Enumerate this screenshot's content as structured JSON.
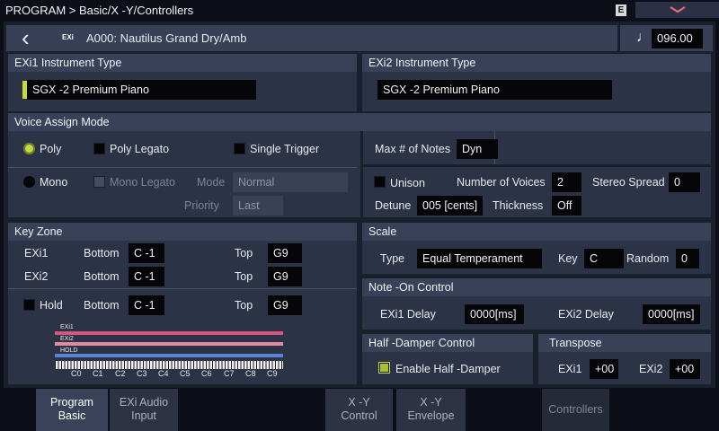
{
  "title_bar": {
    "breadcrumb": "PROGRAM > Basic/X -Y/Controllers",
    "e_badge": "E"
  },
  "header": {
    "back_glyph": "‹",
    "exi_badge": "EXi",
    "program_name": "A000: Nautilus Grand Dry/Amb",
    "tempo": "096.00",
    "note_glyph": "♩"
  },
  "exi1": {
    "title": "EXi1 Instrument Type",
    "value": "SGX -2 Premium Piano"
  },
  "exi2": {
    "title": "EXi2 Instrument Type",
    "value": "SGX -2 Premium Piano"
  },
  "voice_assign": {
    "title": "Voice Assign Mode",
    "poly": "Poly",
    "poly_legato": "Poly Legato",
    "single_trigger": "Single Trigger",
    "mono": "Mono",
    "mono_legato": "Mono Legato",
    "mode_label": "Mode",
    "mode_value": "Normal",
    "priority_label": "Priority",
    "priority_value": "Last"
  },
  "voice_right": {
    "max_notes_label": "Max # of Notes",
    "max_notes_value": "Dyn",
    "unison": "Unison",
    "num_voices_label": "Number of Voices",
    "num_voices_value": "2",
    "stereo_spread_label": "Stereo Spread",
    "stereo_spread_value": "0",
    "detune_label": "Detune",
    "detune_value": "005 [cents]",
    "thickness_label": "Thickness",
    "thickness_value": "Off"
  },
  "key_zone": {
    "title": "Key Zone",
    "exi1_label": "EXi1",
    "exi2_label": "EXi2",
    "hold_label": "Hold",
    "bottom_label": "Bottom",
    "top_label": "Top",
    "exi1_bottom": "C -1",
    "exi1_top": "G9",
    "exi2_bottom": "C -1",
    "exi2_top": "G9",
    "hold_bottom": "C -1",
    "hold_top": "G9",
    "bar_exi1": "EXi1",
    "bar_exi2": "EXi2",
    "bar_hold": "HOLD",
    "octaves": [
      "C0",
      "C1",
      "C2",
      "C3",
      "C4",
      "C5",
      "C6",
      "C7",
      "C8",
      "C9"
    ],
    "colors": {
      "exi1": "#d9547e",
      "exi2": "#e58a9e",
      "hold": "#5c82d6"
    }
  },
  "scale": {
    "title": "Scale",
    "type_label": "Type",
    "type_value": "Equal Temperament",
    "key_label": "Key",
    "key_value": "C",
    "random_label": "Random",
    "random_value": "0"
  },
  "note_on": {
    "title": "Note -On Control",
    "exi1_delay_label": "EXi1 Delay",
    "exi1_delay_value": "0000[ms]",
    "exi2_delay_label": "EXi2 Delay",
    "exi2_delay_value": "0000[ms]"
  },
  "half_damper": {
    "title": "Half -Damper Control",
    "enable_label": "Enable Half -Damper",
    "enabled": true
  },
  "transpose": {
    "title": "Transpose",
    "exi1_label": "EXi1",
    "exi1_value": "+00",
    "exi2_label": "EXi2",
    "exi2_value": "+00"
  },
  "tabs": [
    {
      "line1": "Program",
      "line2": "Basic"
    },
    {
      "line1": "EXi Audio",
      "line2": "Input"
    },
    {
      "line1": "X -Y",
      "line2": "Control"
    },
    {
      "line1": "X -Y",
      "line2": "Envelope"
    },
    {
      "line1": "Controllers",
      "line2": ""
    }
  ],
  "accent": "#c5d944"
}
